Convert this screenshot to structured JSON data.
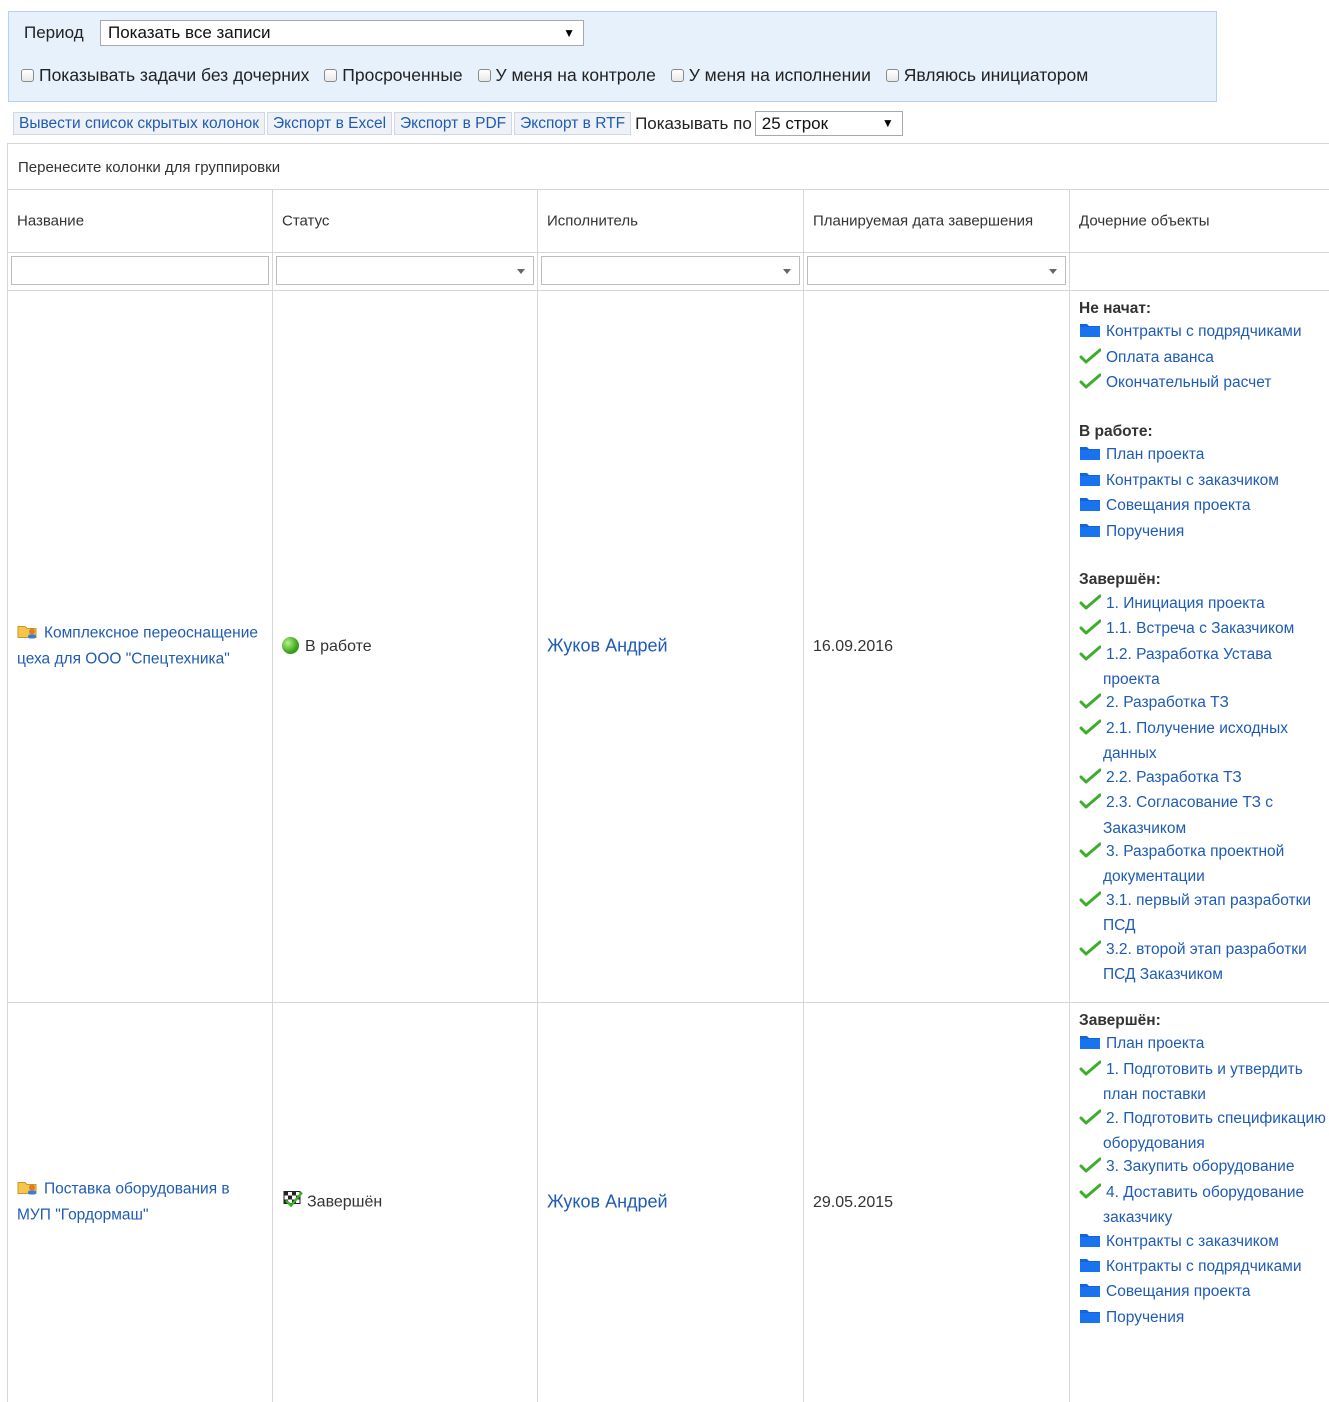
{
  "filters": {
    "period_label": "Период",
    "period_value": "Показать все записи",
    "checkboxes": [
      "Показывать задачи без дочерних",
      "Просроченные",
      "У меня на контроле",
      "У меня на исполнении",
      "Являюсь инициатором"
    ]
  },
  "toolbar": {
    "hidden_columns": "Вывести список скрытых колонок",
    "export_excel": "Экспорт в Excel",
    "export_pdf": "Экспорт в PDF",
    "export_rtf": "Экспорт в RTF",
    "show_by_label": "Показывать по",
    "rows_value": "25 строк"
  },
  "grid": {
    "group_hint": "Перенесите колонки для группировки",
    "columns": [
      "Название",
      "Статус",
      "Исполнитель",
      "Планируемая дата завершения",
      "Дочерние объекты"
    ],
    "rows": [
      {
        "name": "Комплексное переоснащение цеха для ООО \"Спецтехника\"",
        "status": "В работе",
        "executor": "Жуков Андрей",
        "date": "16.09.2016",
        "groups": [
          {
            "title": "Не начат:",
            "items": [
              {
                "icon": "folder-icon",
                "text": "Контракты с подрядчиками"
              },
              {
                "icon": "check-icon",
                "text": "Оплата аванса"
              },
              {
                "icon": "check-icon",
                "text": "Окончательный расчет"
              }
            ]
          },
          {
            "title": "В работе:",
            "items": [
              {
                "icon": "folder-icon",
                "text": "План проекта"
              },
              {
                "icon": "folder-icon",
                "text": "Контракты с заказчиком"
              },
              {
                "icon": "folder-icon",
                "text": "Совещания проекта"
              },
              {
                "icon": "folder-icon",
                "text": "Поручения"
              }
            ]
          },
          {
            "title": "Завершён:",
            "items": [
              {
                "icon": "check-icon",
                "text": "1. Инициация проекта"
              },
              {
                "icon": "check-icon",
                "text": "1.1. Встреча с Заказчиком"
              },
              {
                "icon": "check-icon",
                "text": "1.2. Разработка Устава проекта"
              },
              {
                "icon": "check-icon",
                "text": "2. Разработка ТЗ"
              },
              {
                "icon": "check-icon",
                "text": "2.1. Получение исходных данных"
              },
              {
                "icon": "check-icon",
                "text": "2.2. Разработка ТЗ"
              },
              {
                "icon": "check-icon",
                "text": "2.3. Согласование ТЗ с Заказчиком"
              },
              {
                "icon": "check-icon",
                "text": "3. Разработка проектной документации"
              },
              {
                "icon": "check-icon",
                "text": "3.1. первый этап разработки ПСД"
              },
              {
                "icon": "check-icon",
                "text": "3.2. второй этап разработки ПСД Заказчиком"
              }
            ]
          }
        ]
      },
      {
        "name": "Поставка оборудования в МУП \"Гордормаш\"",
        "status": "Завершён",
        "executor": "Жуков Андрей",
        "date": "29.05.2015",
        "groups": [
          {
            "title": "Завершён:",
            "items": [
              {
                "icon": "folder-icon",
                "text": "План проекта"
              },
              {
                "icon": "check-icon",
                "text": "1. Подготовить и утвердить план поставки"
              },
              {
                "icon": "check-icon",
                "text": "2. Подготовить спецификацию оборудования"
              },
              {
                "icon": "check-icon",
                "text": "3. Закупить оборудование"
              },
              {
                "icon": "check-icon",
                "text": "4. Доставить оборудование заказчику"
              },
              {
                "icon": "folder-icon",
                "text": "Контракты с заказчиком"
              },
              {
                "icon": "folder-icon",
                "text": "Контракты с подрядчиками"
              },
              {
                "icon": "folder-icon",
                "text": "Совещания проекта"
              },
              {
                "icon": "folder-icon",
                "text": "Поручения"
              }
            ]
          }
        ]
      }
    ]
  },
  "colors": {
    "link": "#1f5bb5",
    "panel_bg": "#e7f1fb",
    "panel_border": "#b7d2ee",
    "check_green": "#3dae2b",
    "folder_blue": "#1466d8"
  }
}
